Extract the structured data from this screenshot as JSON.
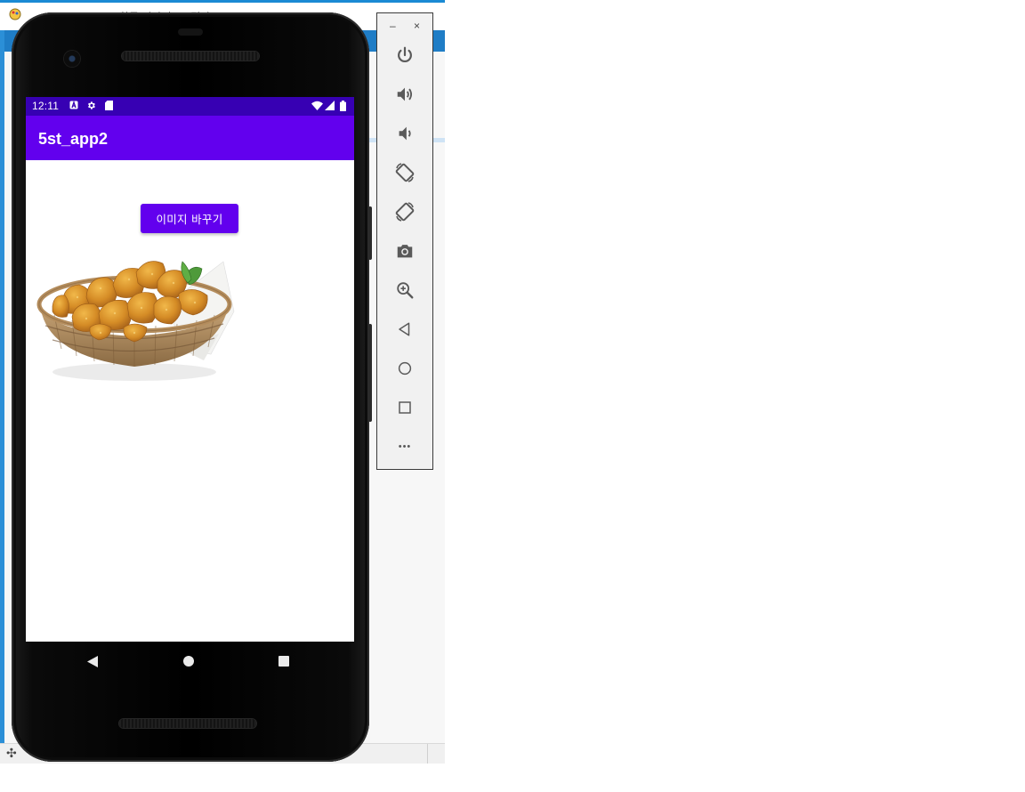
{
  "host": {
    "title": "황금 이야기 - 그림판"
  },
  "phone": {
    "status_bar": {
      "time": "12:11"
    },
    "app_bar": {
      "title": "5st_app2"
    },
    "content": {
      "change_image_button": "이미지 바꾸기",
      "image_subject": "fried-chicken-basket"
    },
    "nav_bar": {
      "buttons": [
        "back",
        "home",
        "recents"
      ]
    }
  },
  "emulator_toolbar": {
    "window_buttons": {
      "minimize": "–",
      "close": "×"
    },
    "buttons": [
      "power",
      "volume-up",
      "volume-down",
      "rotate-left",
      "rotate-right",
      "screenshot",
      "zoom",
      "back",
      "home",
      "overview",
      "more"
    ],
    "more_label": "•••"
  },
  "colors": {
    "primary": "#6200ee",
    "primary_dark": "#3700b3",
    "host_accent": "#1a8ad4"
  }
}
